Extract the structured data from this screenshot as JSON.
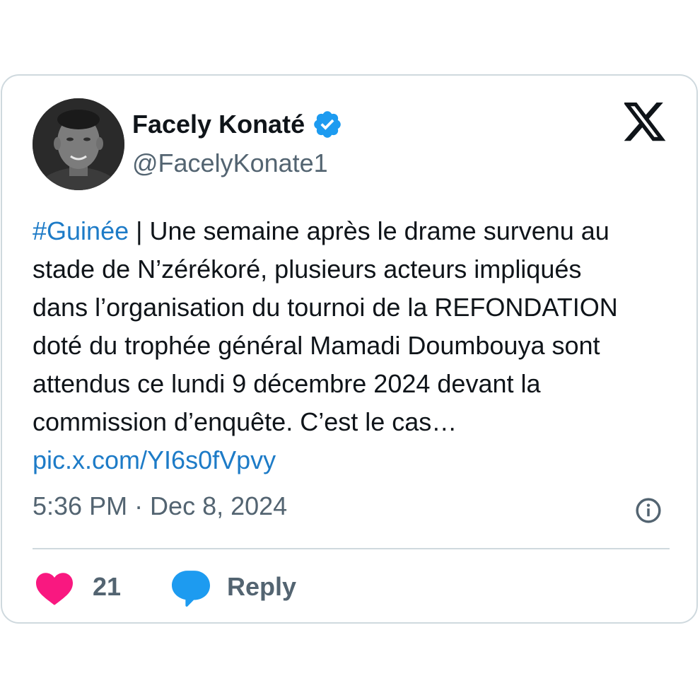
{
  "author": {
    "name": "Facely Konaté",
    "handle": "@FacelyKonate1",
    "verified": true
  },
  "tweet": {
    "hashtag": "#Guinée",
    "lines": [
      " | Une semaine après le drame survenu au",
      "stade de N’zérékoré, plusieurs acteurs impliqués",
      "dans l’organisation du tournoi de la REFONDATION",
      "doté du trophée général Mamadi Doumbouya sont",
      "attendus ce lundi 9 décembre 2024 devant la",
      "commission d’enquête.  C’est le cas…"
    ],
    "link": "pic.x.com/YI6s0fVpvy",
    "timestamp": "5:36 PM · Dec 8, 2024"
  },
  "actions": {
    "like_count": "21",
    "reply_label": "Reply"
  },
  "icons": {
    "brand": "x-logo-icon",
    "verified": "verified-badge-icon",
    "info": "info-icon",
    "like": "heart-icon",
    "reply": "reply-bubble-icon"
  },
  "colors": {
    "text": "#0f1419",
    "secondary": "#536471",
    "link": "#1d7bc7",
    "verified": "#1d9bf0",
    "heart": "#f91880",
    "reply": "#1d9bf0",
    "border": "#cfd9de"
  }
}
